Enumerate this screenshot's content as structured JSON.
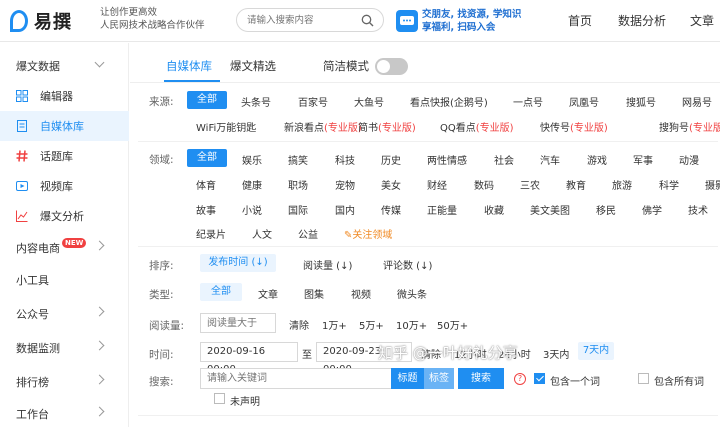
{
  "brand": {
    "name": "易撰",
    "slogan_line1": "让创作更高效",
    "slogan_line2": "人民网技术战略合作伙伴"
  },
  "search": {
    "placeholder": "请输入搜索内容"
  },
  "banner": {
    "line1": "交朋友, 找资源, 学知识",
    "line2": "享福利, 扫码入会"
  },
  "nav": {
    "home": "首页",
    "data_analysis": "数据分析",
    "article": "文章"
  },
  "sidebar": {
    "group_title": "爆文数据",
    "items": [
      {
        "label": "编辑器",
        "icon": "grid-icon"
      },
      {
        "label": "自媒体库",
        "icon": "document-icon"
      },
      {
        "label": "话题库",
        "icon": "hashtag-icon"
      },
      {
        "label": "视频库",
        "icon": "video-icon"
      },
      {
        "label": "爆文分析",
        "icon": "chart-icon"
      }
    ],
    "content_ecommerce": "内容电商",
    "new_badge": "NEW",
    "tools": "小工具",
    "official": "公众号",
    "monitor": "数据监测",
    "ranking": "排行榜",
    "workbench": "工作台"
  },
  "tabs": {
    "tab1": "自媒体库",
    "tab2": "爆文精选",
    "simple_mode": "简洁模式"
  },
  "source": {
    "label": "来源:",
    "items": [
      "全部",
      "头条号",
      "百家号",
      "大鱼号",
      "看点快报(企鹅号)",
      "一点号",
      "凤凰号",
      "搜狐号",
      "网易号"
    ],
    "items2": [
      {
        "name": "WiFi万能钥匙",
        "pro": ""
      },
      {
        "name": "新浪看点",
        "pro": "(专业版)"
      },
      {
        "name": "简书",
        "pro": "(专业版)"
      },
      {
        "name": "QQ看点",
        "pro": "(专业版)"
      },
      {
        "name": "快传号",
        "pro": "(专业版)"
      },
      {
        "name": "搜狗号",
        "pro": "(专业版)"
      }
    ]
  },
  "field": {
    "label": "领域:",
    "row1": [
      "全部",
      "娱乐",
      "搞笑",
      "科技",
      "历史",
      "两性情感",
      "社会",
      "汽车",
      "游戏",
      "军事",
      "动漫"
    ],
    "row2": [
      "体育",
      "健康",
      "职场",
      "宠物",
      "美女",
      "财经",
      "数码",
      "三农",
      "教育",
      "旅游",
      "科学",
      "摄影"
    ],
    "row3": [
      "故事",
      "小说",
      "国际",
      "国内",
      "传媒",
      "正能量",
      "收藏",
      "美文美图",
      "移民",
      "佛学",
      "技术"
    ],
    "row4": [
      "纪录片",
      "人文",
      "公益"
    ],
    "follow": "关注领域"
  },
  "sort": {
    "label": "排序:",
    "items": [
      "发布时间 (↓)",
      "阅读量 (↓)",
      "评论数 (↓)"
    ]
  },
  "type": {
    "label": "类型:",
    "items": [
      "全部",
      "文章",
      "图集",
      "视频",
      "微头条"
    ]
  },
  "reads": {
    "label": "阅读量:",
    "placeholder": "阅读量大于",
    "clear": "清除",
    "options": [
      "1万+",
      "5万+",
      "10万+",
      "50万+"
    ]
  },
  "time": {
    "label": "时间:",
    "start": "2020-09-16 00:00",
    "to": "至",
    "end": "2020-09-23 00:00",
    "clear": "清除",
    "options": [
      "12小时",
      "24小时",
      "3天内",
      "7天内"
    ]
  },
  "keyword": {
    "label": "搜索:",
    "placeholder": "请输入关键词",
    "btn_title": "标题",
    "btn_tag": "标签",
    "btn_search": "搜索",
    "include_one": "包含一个词",
    "include_all": "包含所有词",
    "undeclared": "未声明"
  },
  "watermark": "知乎 @一叶好礼分享"
}
